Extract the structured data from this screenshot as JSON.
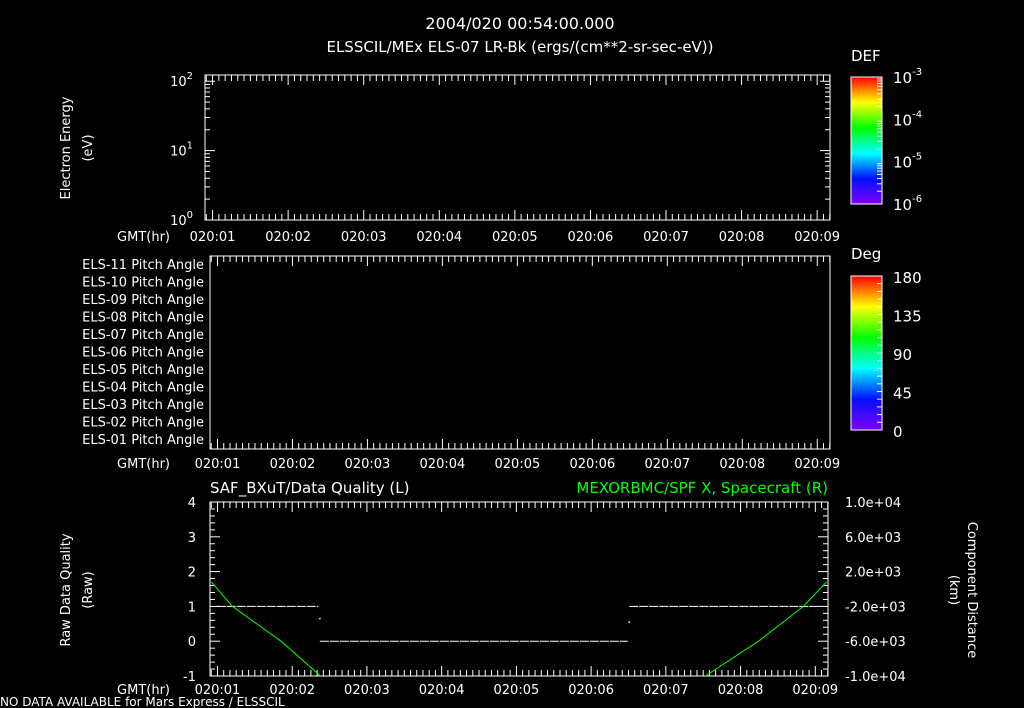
{
  "title": "2004/020 00:54:00.000",
  "subtitle": "ELSSCIL/MEx ELS-07 LR-Bk  (ergs/(cm**2-sr-sec-eV))",
  "footer": "NO DATA AVAILABLE for Mars Express / ELSSCIL",
  "colors": {
    "background": "#000000",
    "axes": "#ffffff",
    "quality": "#ffffff",
    "spacecraft_x": "#00ff00"
  },
  "x_axis": {
    "label": "GMT(hr)",
    "ticks": [
      "020:01",
      "020:02",
      "020:03",
      "020:04",
      "020:05",
      "020:06",
      "020:07",
      "020:08",
      "020:09"
    ],
    "range_hr": [
      0.9,
      9.17
    ]
  },
  "chart_data": [
    {
      "type": "heatmap",
      "ylabel": [
        "Electron Energy",
        "(eV)"
      ],
      "yscale": "log",
      "ylim": [
        1,
        123
      ],
      "yticks": [
        {
          "base": "10",
          "exp": "0",
          "value": 1
        },
        {
          "base": "10",
          "exp": "1",
          "value": 10
        },
        {
          "base": "10",
          "exp": "2",
          "value": 100
        }
      ],
      "values": [],
      "colorbar": {
        "title": "DEF",
        "scale": "log",
        "ticks": [
          {
            "base": "10",
            "exp": "-3"
          },
          {
            "base": "10",
            "exp": "-4"
          },
          {
            "base": "10",
            "exp": "-5"
          },
          {
            "base": "10",
            "exp": "-6"
          }
        ],
        "range": [
          1e-06,
          0.001
        ]
      }
    },
    {
      "type": "heatmap",
      "row_labels": [
        "ELS-11 Pitch Angle",
        "ELS-10 Pitch Angle",
        "ELS-09 Pitch Angle",
        "ELS-08 Pitch Angle",
        "ELS-07 Pitch Angle",
        "ELS-06 Pitch Angle",
        "ELS-05 Pitch Angle",
        "ELS-04 Pitch Angle",
        "ELS-03 Pitch Angle",
        "ELS-02 Pitch Angle",
        "ELS-01 Pitch Angle"
      ],
      "values": [],
      "colorbar": {
        "title": "Deg",
        "ticks": [
          "180",
          "135",
          "90",
          "45",
          "0"
        ],
        "range": [
          0,
          180
        ]
      }
    },
    {
      "type": "line",
      "left_title": "SAF_BXuT/Data Quality (L)",
      "right_title": "MEXORBMC/SPF X, Spacecraft (R)",
      "ylabel_left": [
        "Raw Data Quality",
        "(Raw)"
      ],
      "ylabel_right": [
        "Component Distance",
        "(km)"
      ],
      "ylim_left": [
        -1,
        4
      ],
      "yticks_left": [
        "4",
        "3",
        "2",
        "1",
        "0",
        "-1"
      ],
      "ylim_right": [
        -10000,
        10000
      ],
      "yticks_right": [
        "1.0e+04",
        "6.0e+03",
        "2.0e+03",
        "-2.0e+03",
        "-6.0e+03",
        "-1.0e+04"
      ],
      "series": [
        {
          "axis": "left",
          "style": "dashed-segments",
          "segments": [
            [
              [
                0.99,
                1
              ],
              [
                2.35,
                1
              ]
            ],
            [
              [
                2.37,
                0
              ],
              [
                6.49,
                0
              ]
            ],
            [
              [
                6.51,
                1
              ],
              [
                9.05,
                1
              ]
            ]
          ],
          "points": [
            [
              2.36,
              0.67
            ],
            [
              6.5,
              0.57
            ]
          ]
        },
        {
          "axis": "right",
          "segments": [
            [
              [
                0.92,
                800
              ],
              [
                1.2,
                -2000
              ],
              [
                1.85,
                -6000
              ],
              [
                2.38,
                -10000
              ]
            ],
            [
              [
                7.53,
                -10000
              ],
              [
                8.24,
                -6000
              ],
              [
                8.84,
                -2000
              ],
              [
                9.15,
                800
              ]
            ]
          ]
        }
      ]
    }
  ]
}
